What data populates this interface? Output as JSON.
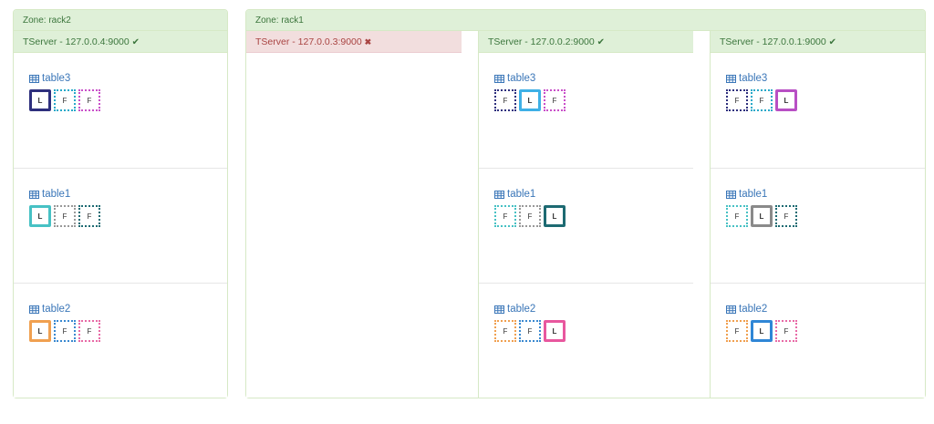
{
  "zones": [
    {
      "label": "Zone: rack2",
      "tservers": [
        {
          "label": "TServer - 127.0.0.4:9000",
          "status": "ok",
          "status_icon": "✔",
          "tables": [
            {
              "name": "table3",
              "tablets": [
                {
                  "role": "L",
                  "color": "#2e2f7d",
                  "leader": true
                },
                {
                  "role": "F",
                  "color": "#27a9c9",
                  "leader": false
                },
                {
                  "role": "F",
                  "color": "#c94fc9",
                  "leader": false
                }
              ]
            },
            {
              "name": "table1",
              "tablets": [
                {
                  "role": "L",
                  "color": "#47c1c4",
                  "leader": true
                },
                {
                  "role": "F",
                  "color": "#999999",
                  "leader": false
                },
                {
                  "role": "F",
                  "color": "#1d6a72",
                  "leader": false
                }
              ]
            },
            {
              "name": "table2",
              "tablets": [
                {
                  "role": "L",
                  "color": "#f0a050",
                  "leader": true
                },
                {
                  "role": "F",
                  "color": "#3a89d0",
                  "leader": false
                },
                {
                  "role": "F",
                  "color": "#e86aa6",
                  "leader": false
                }
              ]
            }
          ]
        }
      ]
    },
    {
      "label": "Zone: rack1",
      "tservers": [
        {
          "label": "TServer - 127.0.0.3:9000",
          "status": "bad",
          "status_icon": "✖",
          "tables": []
        },
        {
          "label": "TServer - 127.0.0.2:9000",
          "status": "ok",
          "status_icon": "✔",
          "tables": [
            {
              "name": "table3",
              "tablets": [
                {
                  "role": "F",
                  "color": "#2e2f7d",
                  "leader": false
                },
                {
                  "role": "L",
                  "color": "#3eb0e6",
                  "leader": true
                },
                {
                  "role": "F",
                  "color": "#c94fc9",
                  "leader": false
                }
              ]
            },
            {
              "name": "table1",
              "tablets": [
                {
                  "role": "F",
                  "color": "#47c1c4",
                  "leader": false
                },
                {
                  "role": "F",
                  "color": "#999999",
                  "leader": false
                },
                {
                  "role": "L",
                  "color": "#1d6a72",
                  "leader": true
                }
              ]
            },
            {
              "name": "table2",
              "tablets": [
                {
                  "role": "F",
                  "color": "#f0a050",
                  "leader": false
                },
                {
                  "role": "F",
                  "color": "#3a89d0",
                  "leader": false
                },
                {
                  "role": "L",
                  "color": "#e8579e",
                  "leader": true
                }
              ]
            }
          ]
        },
        {
          "label": "TServer - 127.0.0.1:9000",
          "status": "ok",
          "status_icon": "✔",
          "tables": [
            {
              "name": "table3",
              "tablets": [
                {
                  "role": "F",
                  "color": "#2e2f7d",
                  "leader": false
                },
                {
                  "role": "F",
                  "color": "#27a9c9",
                  "leader": false
                },
                {
                  "role": "L",
                  "color": "#b84fc4",
                  "leader": true
                }
              ]
            },
            {
              "name": "table1",
              "tablets": [
                {
                  "role": "F",
                  "color": "#47c1c4",
                  "leader": false
                },
                {
                  "role": "L",
                  "color": "#8a8a8a",
                  "leader": true
                },
                {
                  "role": "F",
                  "color": "#1d6a72",
                  "leader": false
                }
              ]
            },
            {
              "name": "table2",
              "tablets": [
                {
                  "role": "F",
                  "color": "#f0a050",
                  "leader": false
                },
                {
                  "role": "L",
                  "color": "#2f86d6",
                  "leader": true
                },
                {
                  "role": "F",
                  "color": "#e86aa6",
                  "leader": false
                }
              ]
            }
          ]
        }
      ]
    }
  ],
  "icons": {
    "table": "table-grid-icon",
    "ok": "check-icon",
    "bad": "cross-icon"
  }
}
